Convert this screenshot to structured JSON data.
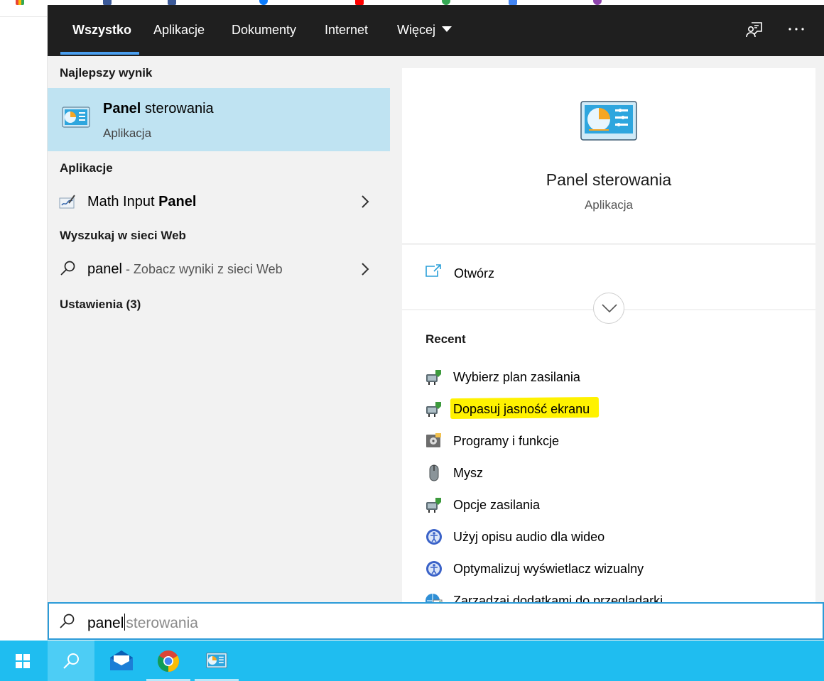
{
  "colors": {
    "topbar": "#1f1f1f",
    "accent": "#4a9ff0",
    "best_result_bg": "#bfe3f2",
    "taskbar": "#1fbdf0",
    "highlight": "#fff200"
  },
  "tabs": [
    {
      "label": "Wszystko",
      "active": true
    },
    {
      "label": "Aplikacje",
      "active": false
    },
    {
      "label": "Dokumenty",
      "active": false
    },
    {
      "label": "Internet",
      "active": false
    },
    {
      "label": "Więcej",
      "active": false
    }
  ],
  "top_icons": [
    "feedback-icon",
    "more-options-icon"
  ],
  "results": {
    "best_header": "Najlepszy wynik",
    "best": {
      "title_bold": "Panel",
      "title_rest": " sterowania",
      "subtitle": "Aplikacja",
      "icon": "control-panel-icon"
    },
    "apps_header": "Aplikacje",
    "apps": [
      {
        "label_plain": "Math Input ",
        "label_bold": "Panel",
        "icon": "math-input-panel-icon"
      }
    ],
    "web_header": "Wyszukaj w sieci Web",
    "web": [
      {
        "query": "panel",
        "hint": " - Zobacz wyniki z sieci Web",
        "icon": "search-icon"
      }
    ],
    "settings_header": "Ustawienia (3)"
  },
  "preview": {
    "title": "Panel sterowania",
    "subtitle": "Aplikacja",
    "open_label": "Otwórz",
    "recent_header": "Recent",
    "recent": [
      {
        "label": "Wybierz plan zasilania",
        "icon": "power-options-icon"
      },
      {
        "label": "Dopasuj jasność ekranu",
        "icon": "power-options-icon",
        "highlighted": true
      },
      {
        "label": "Programy i funkcje",
        "icon": "programs-features-icon"
      },
      {
        "label": "Mysz",
        "icon": "mouse-icon"
      },
      {
        "label": "Opcje zasilania",
        "icon": "power-options-icon"
      },
      {
        "label": "Użyj opisu audio dla wideo",
        "icon": "ease-of-access-icon"
      },
      {
        "label": "Optymalizuj wyświetlacz wizualny",
        "icon": "ease-of-access-icon"
      },
      {
        "label": "Zarządzaj dodatkami do przeglądarki",
        "icon": "internet-options-icon"
      }
    ]
  },
  "search": {
    "typed": "panel",
    "suggestion": "sterowania"
  },
  "taskbar": [
    "start-icon",
    "search-icon",
    "mail-icon",
    "chrome-icon",
    "control-panel-icon"
  ]
}
